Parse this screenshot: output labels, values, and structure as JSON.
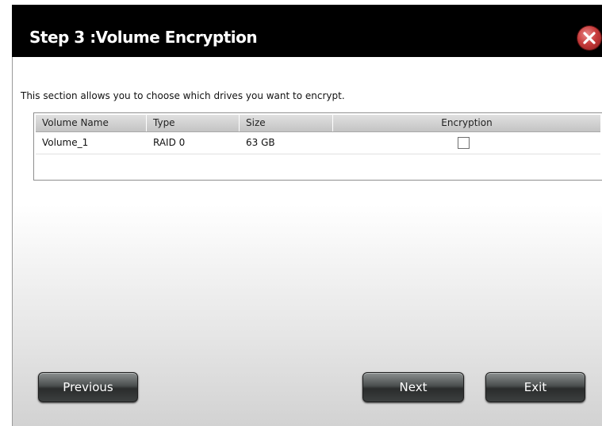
{
  "dialog": {
    "title": "Step 3 :Volume Encryption",
    "description": "This section allows you to choose which drives you want to encrypt."
  },
  "table": {
    "columns": [
      "Volume Name",
      "Type",
      "Size",
      "Encryption"
    ],
    "rows": [
      {
        "volume_name": "Volume_1",
        "type": "RAID 0",
        "size": "63 GB",
        "encryption": false
      }
    ]
  },
  "buttons": {
    "previous": "Previous",
    "next": "Next",
    "exit": "Exit"
  },
  "colors": {
    "title_bar": "#000000",
    "close_button": "#c83c3c",
    "button_dark": "#2a2c2c"
  }
}
